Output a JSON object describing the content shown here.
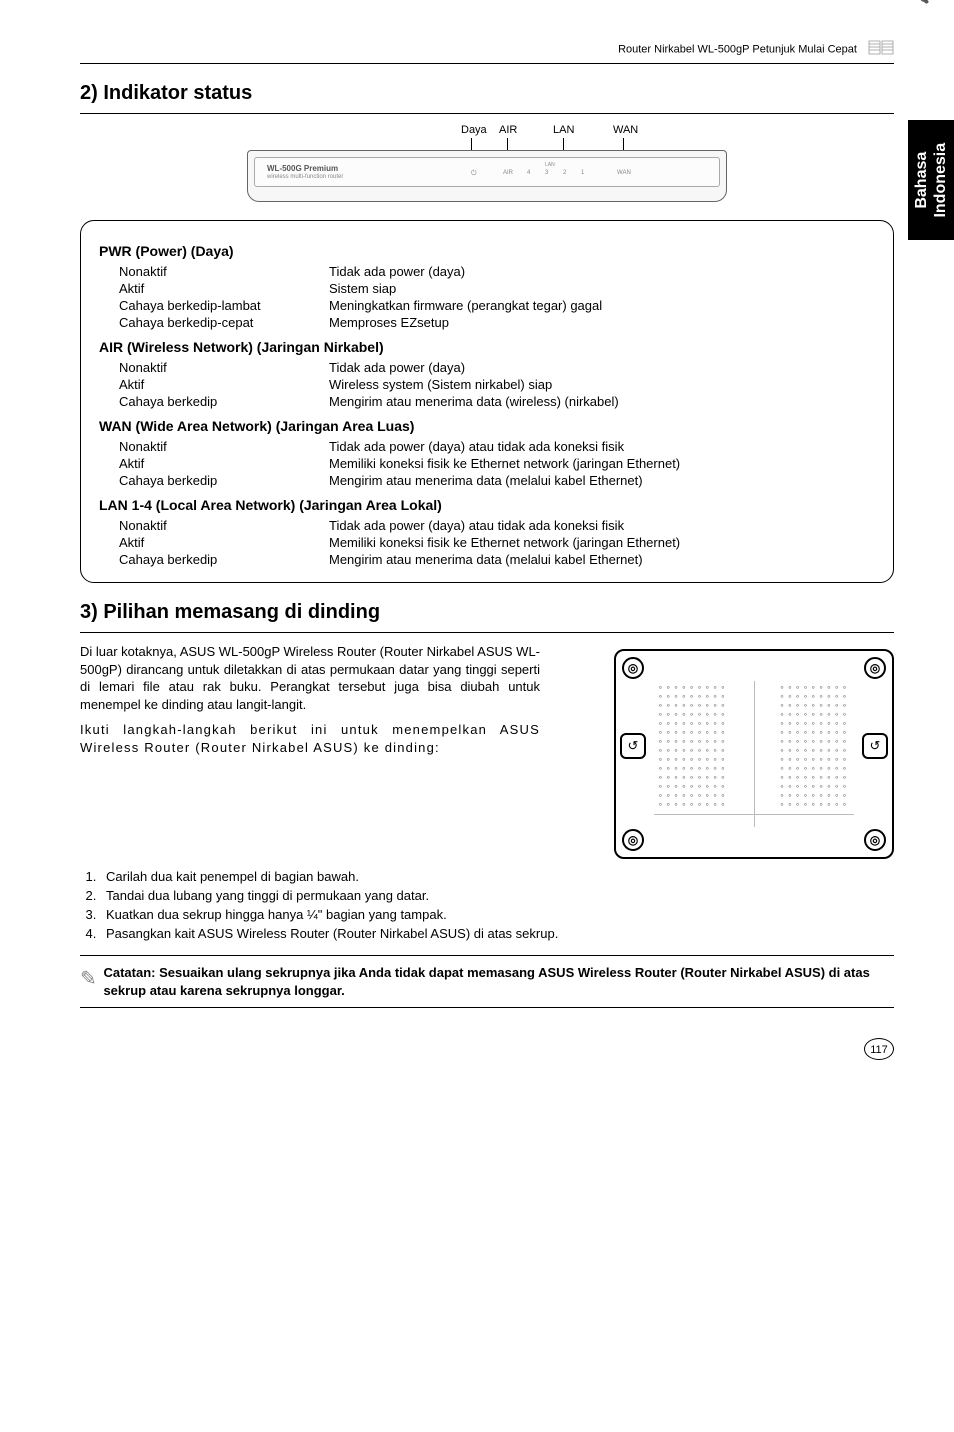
{
  "header": {
    "text": "Router Nirkabel WL-500gP   Petunjuk Mulai Cepat"
  },
  "sideTab": {
    "line1": "Bahasa",
    "line2": "Indonesia"
  },
  "section2": {
    "title": "2) Indikator status",
    "labels": {
      "daya": "Daya",
      "air": "AIR",
      "lan": "LAN",
      "wan": "WAN"
    },
    "device": {
      "name": "WL-500G Premium",
      "sub": "wireless multi-function router",
      "ledPwr": "⏻",
      "ledAir": "AIR",
      "lan4": "4",
      "lan3": "3",
      "lan2": "2",
      "lan1": "1",
      "ledWan": "WAN",
      "lanLabel": "LAN"
    },
    "groups": [
      {
        "heading": "PWR (Power) (Daya)",
        "rows": [
          [
            "Nonaktif",
            "Tidak ada power (daya)"
          ],
          [
            "Aktif",
            "Sistem siap"
          ],
          [
            "Cahaya berkedip-lambat",
            "Meningkatkan firmware (perangkat tegar) gagal"
          ],
          [
            "Cahaya berkedip-cepat",
            "Memproses EZsetup"
          ]
        ]
      },
      {
        "heading": "AIR (Wireless Network) (Jaringan Nirkabel)",
        "rows": [
          [
            "Nonaktif",
            "Tidak ada power (daya)"
          ],
          [
            "Aktif",
            "Wireless system (Sistem nirkabel) siap"
          ],
          [
            "Cahaya berkedip",
            "Mengirim atau menerima data (wireless) (nirkabel)"
          ]
        ]
      },
      {
        "heading": "WAN (Wide Area Network) (Jaringan Area Luas)",
        "rows": [
          [
            "Nonaktif",
            "Tidak ada power (daya) atau tidak ada koneksi fisik"
          ],
          [
            "Aktif",
            "Memiliki koneksi fisik ke Ethernet network (jaringan Ethernet)"
          ],
          [
            "Cahaya berkedip",
            "Mengirim atau menerima data (melalui kabel Ethernet)"
          ]
        ]
      },
      {
        "heading": "LAN 1-4 (Local Area Network) (Jaringan Area Lokal)",
        "rows": [
          [
            "Nonaktif",
            "Tidak ada power (daya) atau tidak ada koneksi fisik"
          ],
          [
            "Aktif",
            "Memiliki koneksi fisik ke Ethernet network (jaringan Ethernet)"
          ],
          [
            "Cahaya berkedip",
            "Mengirim atau menerima data (melalui kabel Ethernet)"
          ]
        ]
      }
    ]
  },
  "section3": {
    "title": "3) Pilihan memasang di dinding",
    "para1": "Di luar kotaknya, ASUS WL-500gP Wireless Router (Router Nirkabel ASUS WL-500gP) dirancang untuk diletakkan di atas permukaan datar yang tinggi seperti di lemari file atau rak buku. Perangkat tersebut juga bisa diubah untuk menempel ke dinding atau langit-langit.",
    "para2": "Ikuti langkah-langkah berikut ini untuk menempelkan ASUS Wireless Router (Router Nirkabel ASUS) ke dinding:",
    "steps": [
      "Carilah dua kait penempel di bagian bawah.",
      "Tandai dua lubang yang tinggi di permukaan yang datar.",
      "Kuatkan dua sekrup hingga hanya ¼\" bagian yang tampak.",
      "Pasangkan kait ASUS Wireless Router (Router Nirkabel ASUS) di atas sekrup."
    ],
    "note": "Catatan: Sesuaikan ulang sekrupnya jika Anda tidak dapat memasang ASUS Wireless Router (Router Nirkabel ASUS) di atas sekrup atau karena sekrupnya longgar."
  },
  "icons": {
    "screw": "◎",
    "hook": "↺",
    "pencil": "✎",
    "cable": "🔌"
  },
  "footer": {
    "page": "117"
  }
}
